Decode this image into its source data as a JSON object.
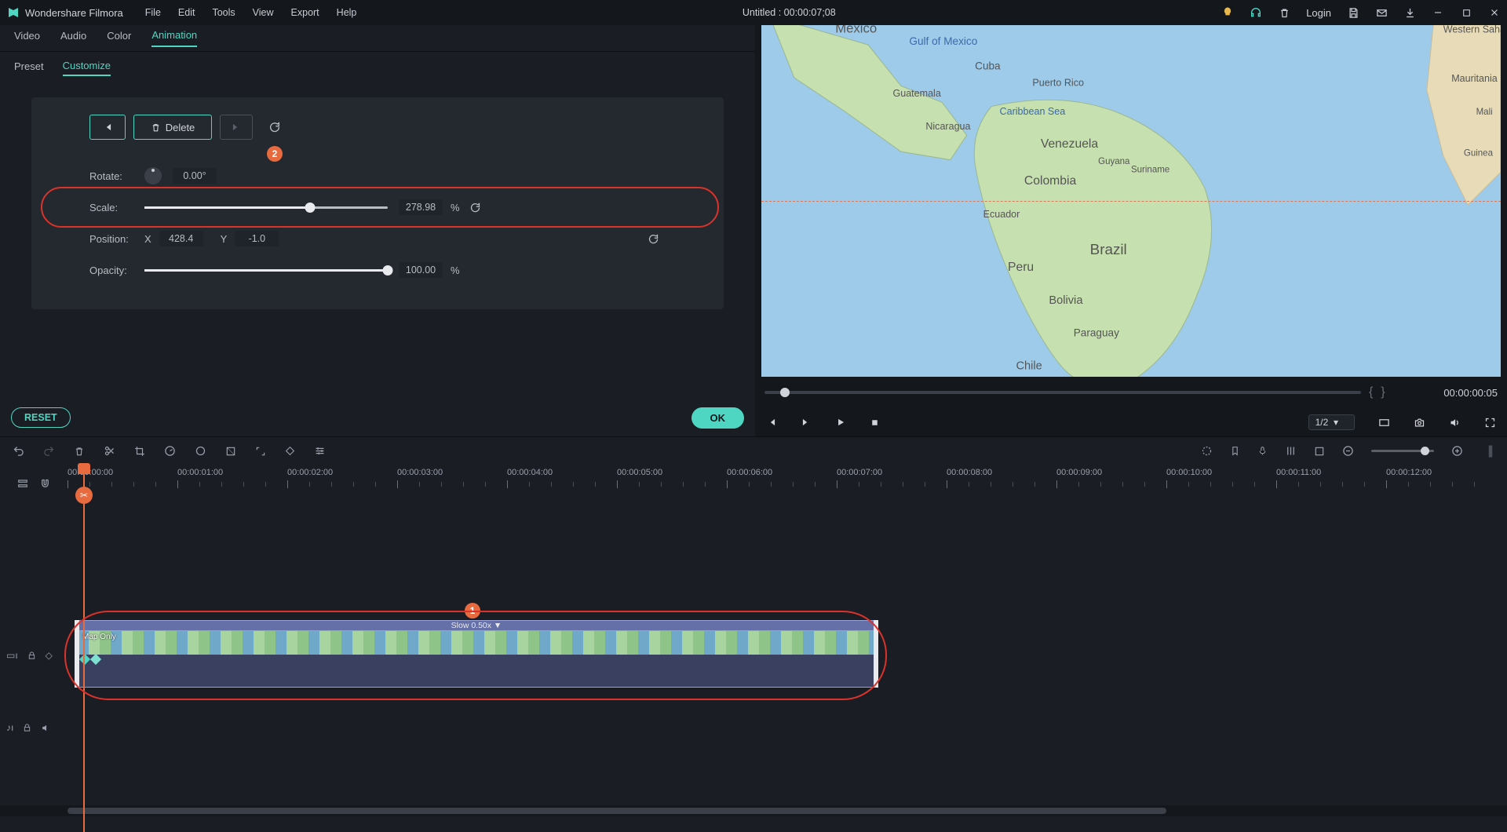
{
  "app": {
    "name": "Wondershare Filmora",
    "title": "Untitled : 00:00:07;08",
    "login": "Login"
  },
  "menu": [
    "File",
    "Edit",
    "Tools",
    "View",
    "Export",
    "Help"
  ],
  "tabs": {
    "categories": [
      "Video",
      "Audio",
      "Color",
      "Animation"
    ],
    "active_cat": 3,
    "subs": [
      "Preset",
      "Customize"
    ],
    "active_sub": 1
  },
  "kf": {
    "delete": "Delete"
  },
  "props": {
    "rotate": {
      "label": "Rotate:",
      "value": "0.00",
      "unit": "°"
    },
    "scale": {
      "label": "Scale:",
      "value": "278.98",
      "unit": "%",
      "pct": 68
    },
    "position": {
      "label": "Position:",
      "x_label": "X",
      "x": "428.4",
      "y_label": "Y",
      "y": "-1.0"
    },
    "opacity": {
      "label": "Opacity:",
      "value": "100.00",
      "unit": "%",
      "pct": 100
    }
  },
  "buttons": {
    "reset": "RESET",
    "ok": "OK"
  },
  "preview": {
    "timecode": "00:00:00:05",
    "zoom": "1/2"
  },
  "ruler": [
    "00:00:00:00",
    "00:00:01:00",
    "00:00:02:00",
    "00:00:03:00",
    "00:00:04:00",
    "00:00:05:00",
    "00:00:06:00",
    "00:00:07:00",
    "00:00:08:00",
    "00:00:09:00",
    "00:00:10:00",
    "00:00:11:00",
    "00:00:12:00"
  ],
  "clip": {
    "speed": "Slow 0.50x ▼",
    "name": "Map Only"
  },
  "annot": {
    "b1": "1",
    "b2": "2"
  }
}
